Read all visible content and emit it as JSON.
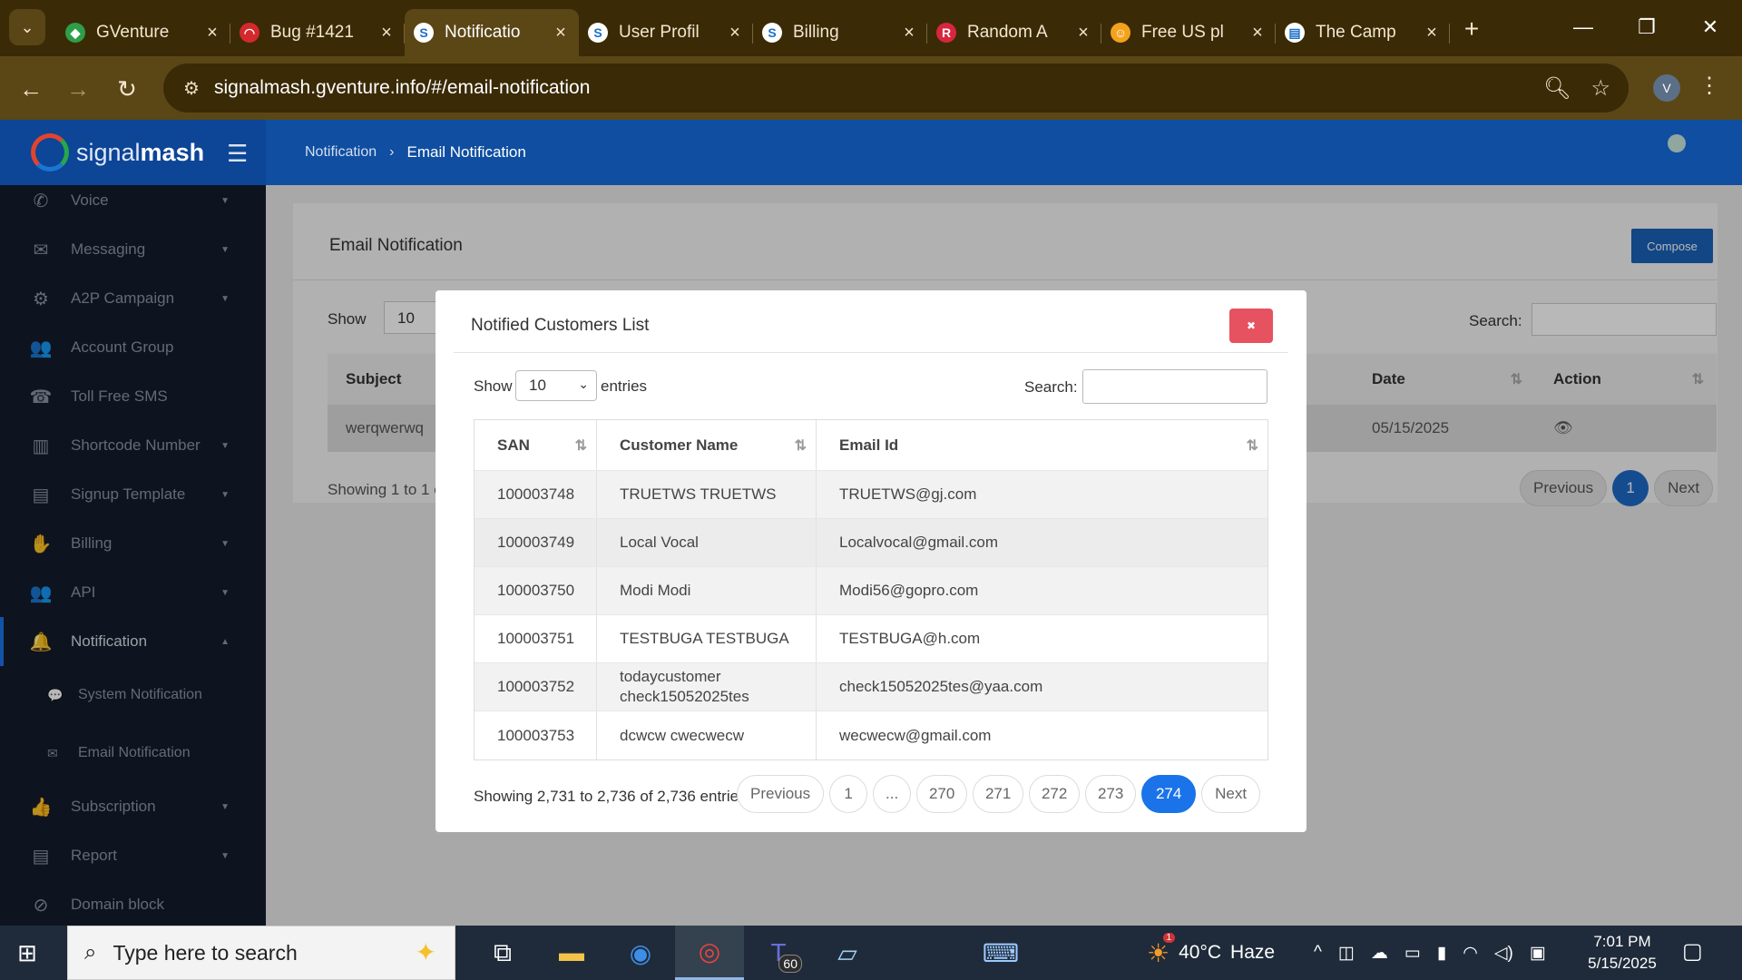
{
  "browser": {
    "tabs": [
      {
        "label": "GVenture",
        "fav_color": "#2e9e48",
        "fav_glyph": "◆"
      },
      {
        "label": "Bug #1421",
        "fav_color": "#d4282d",
        "fav_glyph": "◠"
      },
      {
        "label": "Notificatio",
        "fav_color": "#ffffff",
        "fav_glyph": "S",
        "active": true
      },
      {
        "label": "User Profil",
        "fav_color": "#ffffff",
        "fav_glyph": "S"
      },
      {
        "label": "Billing",
        "fav_color": "#ffffff",
        "fav_glyph": "S"
      },
      {
        "label": "Random A",
        "fav_color": "#d7263d",
        "fav_glyph": "R"
      },
      {
        "label": "Free US pl",
        "fav_color": "#f3a21b",
        "fav_glyph": "☺"
      },
      {
        "label": "The Camp",
        "fav_color": "#ffffff",
        "fav_glyph": "▤"
      }
    ],
    "url": "signalmash.gventure.info/#/email-notification",
    "profile_initial": "V"
  },
  "app": {
    "logo_prefix": "signal",
    "logo_suffix": "mash",
    "breadcrumb": [
      "Notification",
      "Email Notification"
    ]
  },
  "sidebar": {
    "items": [
      {
        "label": "Voice",
        "icon": "phone-icon",
        "glyph": "✆",
        "caret": true
      },
      {
        "label": "Messaging",
        "icon": "envelope-icon",
        "glyph": "✉",
        "caret": true
      },
      {
        "label": "A2P Campaign",
        "icon": "gear-icon",
        "glyph": "⚙",
        "caret": true
      },
      {
        "label": "Account Group",
        "icon": "users-icon",
        "glyph": "👥",
        "caret": false
      },
      {
        "label": "Toll Free SMS",
        "icon": "phone-square-icon",
        "glyph": "☎",
        "caret": false
      },
      {
        "label": "Shortcode Number",
        "icon": "shortcode-icon",
        "glyph": "▥",
        "caret": true
      },
      {
        "label": "Signup Template",
        "icon": "file-icon",
        "glyph": "▤",
        "caret": true
      },
      {
        "label": "Billing",
        "icon": "billing-icon",
        "glyph": "✋",
        "caret": true
      },
      {
        "label": "API",
        "icon": "api-icon",
        "glyph": "👥",
        "caret": true
      },
      {
        "label": "Notification",
        "icon": "bell-icon",
        "glyph": "🔔",
        "caret": true,
        "active": true
      }
    ],
    "sub_items": [
      {
        "label": "System Notification",
        "icon": "comment-icon",
        "glyph": "💬"
      },
      {
        "label": "Email Notification",
        "icon": "envelope-icon",
        "glyph": "✉"
      }
    ],
    "items_after": [
      {
        "label": "Subscription",
        "icon": "thumb-icon",
        "glyph": "👍",
        "caret": true
      },
      {
        "label": "Report",
        "icon": "report-icon",
        "glyph": "▤",
        "caret": true
      },
      {
        "label": "Domain block",
        "icon": "block-icon",
        "glyph": "⊘",
        "caret": false
      }
    ]
  },
  "page": {
    "title": "Email Notification",
    "compose_label": "Compose",
    "show_label": "Show",
    "show_value": "10",
    "search_label": "Search:",
    "columns": [
      "Subject",
      "Date",
      "Action"
    ],
    "row": {
      "subject": "werqwerwq",
      "date": "05/15/2025",
      "action_icon": "eye-icon"
    },
    "showing": "Showing 1 to 1 o",
    "pagination": {
      "previous": "Previous",
      "current": "1",
      "next": "Next"
    }
  },
  "modal": {
    "title": "Notified Customers List",
    "show_label": "Show",
    "show_value": "10",
    "entries_label": "entries",
    "search_label": "Search:",
    "columns": [
      "SAN",
      "Customer Name",
      "Email Id"
    ],
    "rows": [
      {
        "san": "100003748",
        "name": "TRUETWS TRUETWS",
        "email": "TRUETWS@gj.com"
      },
      {
        "san": "100003749",
        "name": "Local Vocal",
        "email": "Localvocal@gmail.com"
      },
      {
        "san": "100003750",
        "name": "Modi Modi",
        "email": "Modi56@gopro.com"
      },
      {
        "san": "100003751",
        "name": "TESTBUGA TESTBUGA",
        "email": "TESTBUGA@h.com"
      },
      {
        "san": "100003752",
        "name": "todaycustomer check15052025tes",
        "email": "check15052025tes@yaa.com"
      },
      {
        "san": "100003753",
        "name": "dcwcw cwecwecw",
        "email": "wecwecw@gmail.com"
      }
    ],
    "info": "Showing 2,731 to 2,736 of 2,736 entries",
    "pagination": {
      "previous": "Previous",
      "pages": [
        "1",
        "...",
        "270",
        "271",
        "272",
        "273",
        "274"
      ],
      "current": "274",
      "next": "Next"
    }
  },
  "taskbar": {
    "search_placeholder": "Type here to search",
    "teams_badge": "60",
    "weather_badge": "1",
    "temperature": "40°C",
    "condition": "Haze",
    "time": "7:01 PM",
    "date": "5/15/2025"
  }
}
